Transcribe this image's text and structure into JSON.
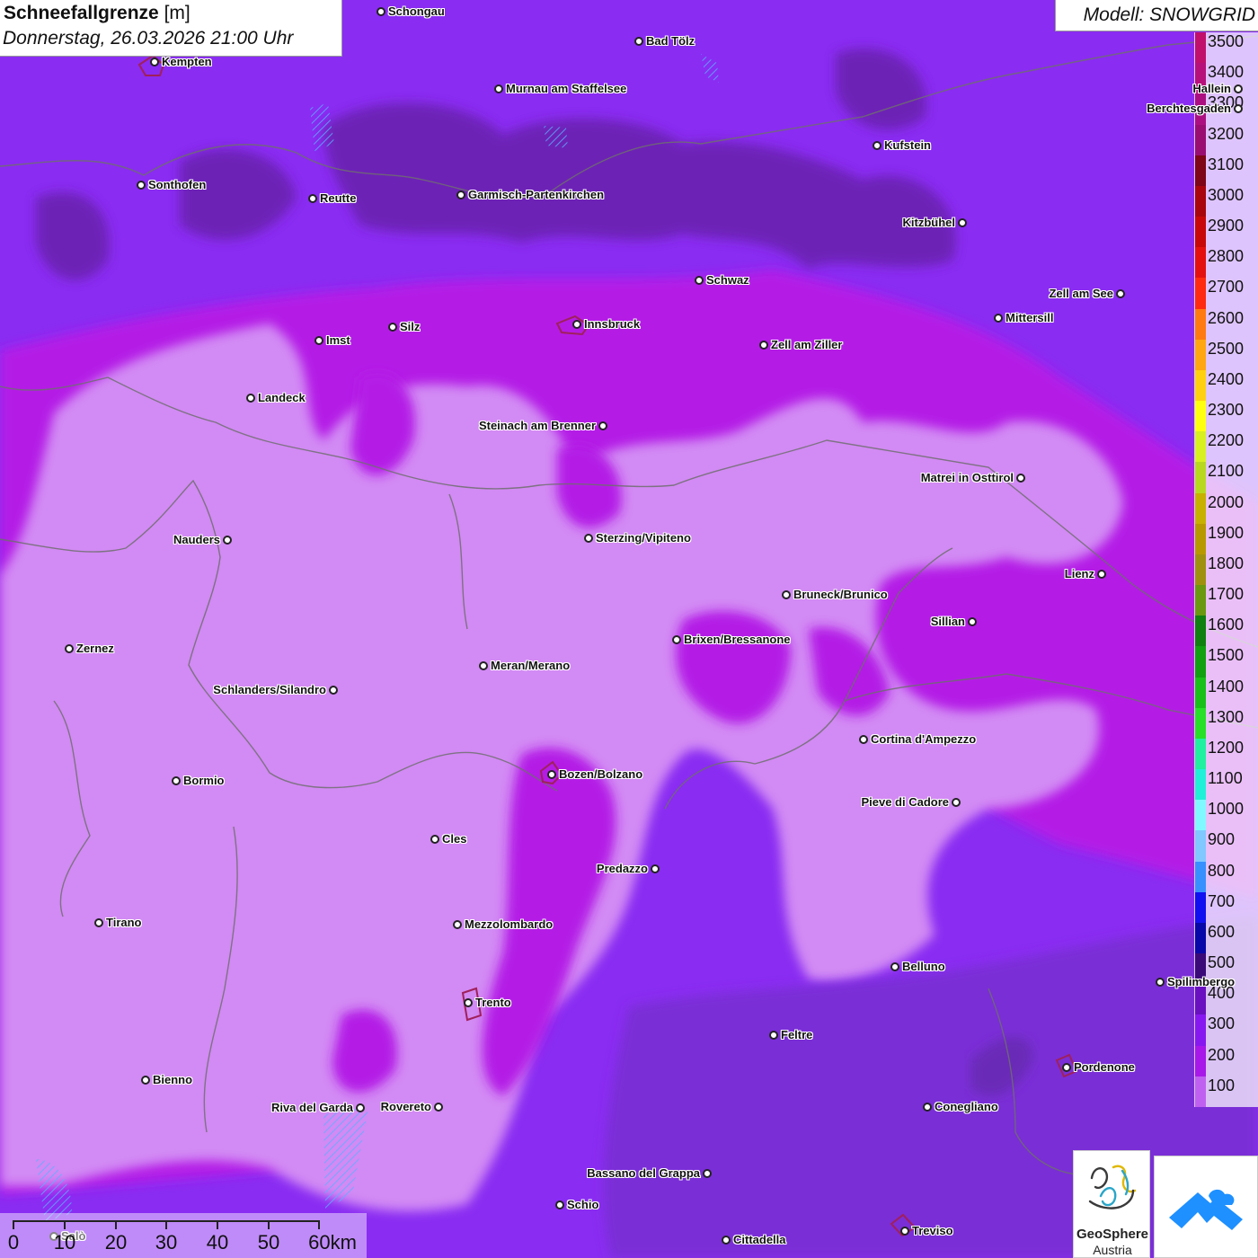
{
  "header": {
    "title": "Schneefallgrenze",
    "unit": "[m]",
    "datetime": "Donnerstag, 26.03.2026 21:00 Uhr"
  },
  "model": {
    "label": "Modell: SNOWGRID"
  },
  "legend": {
    "values": [
      "3500",
      "3400",
      "3300",
      "3200",
      "3100",
      "3000",
      "2900",
      "2800",
      "2700",
      "2600",
      "2500",
      "2400",
      "2300",
      "2200",
      "2100",
      "2000",
      "1900",
      "1800",
      "1700",
      "1600",
      "1500",
      "1400",
      "1300",
      "1200",
      "1100",
      "1000",
      "900",
      "800",
      "700",
      "600",
      "500",
      "400",
      "300",
      "200",
      "100"
    ],
    "colors": [
      "#c0106c",
      "#b8107a",
      "#ac1080",
      "#9a0e72",
      "#7e0616",
      "#a8060c",
      "#c80808",
      "#e41010",
      "#ff2a10",
      "#ff7a10",
      "#ffa610",
      "#ffd010",
      "#ffff10",
      "#d8f020",
      "#b8d820",
      "#c8b000",
      "#b89800",
      "#a09010",
      "#6a9810",
      "#108010",
      "#10a010",
      "#18c018",
      "#28e028",
      "#20f0a0",
      "#20f0d8",
      "#80f8ff",
      "#80c8ff",
      "#3890ff",
      "#1010f0",
      "#0808a8",
      "#3a0a78",
      "#6a10c0",
      "#8818f0",
      "#a818e8",
      "#c060f0"
    ]
  },
  "map": {
    "cities": [
      {
        "name": "Schongau"
      },
      {
        "name": "Bad Tölz"
      },
      {
        "name": "Kempten"
      },
      {
        "name": "Murnau am Staffelsee"
      },
      {
        "name": "Berchtesgaden"
      },
      {
        "name": "Hallein"
      },
      {
        "name": "Kufstein"
      },
      {
        "name": "Sonthofen"
      },
      {
        "name": "Reutte"
      },
      {
        "name": "Garmisch-Partenkirchen"
      },
      {
        "name": "Kitzbühel"
      },
      {
        "name": "Schwaz"
      },
      {
        "name": "Zell am See"
      },
      {
        "name": "Mittersill"
      },
      {
        "name": "Innsbruck"
      },
      {
        "name": "Silz"
      },
      {
        "name": "Imst"
      },
      {
        "name": "Zell am Ziller"
      },
      {
        "name": "Landeck"
      },
      {
        "name": "Steinach am Brenner"
      },
      {
        "name": "Matrei in Osttirol"
      },
      {
        "name": "Nauders"
      },
      {
        "name": "Sterzing/Vipiteno"
      },
      {
        "name": "Lienz"
      },
      {
        "name": "Bruneck/Brunico"
      },
      {
        "name": "Sillian"
      },
      {
        "name": "Brixen/Bressanone"
      },
      {
        "name": "Zernez"
      },
      {
        "name": "Meran/Merano"
      },
      {
        "name": "Schlanders/Silandro"
      },
      {
        "name": "Cortina d'Ampezzo"
      },
      {
        "name": "Bozen/Bolzano"
      },
      {
        "name": "Bormio"
      },
      {
        "name": "Pieve di Cadore"
      },
      {
        "name": "Cles"
      },
      {
        "name": "Predazzo"
      },
      {
        "name": "Tirano"
      },
      {
        "name": "Mezzolombardo"
      },
      {
        "name": "Belluno"
      },
      {
        "name": "Spilimbergo"
      },
      {
        "name": "Trento"
      },
      {
        "name": "Feltre"
      },
      {
        "name": "Pordenone"
      },
      {
        "name": "Bienno"
      },
      {
        "name": "Riva del Garda"
      },
      {
        "name": "Rovereto"
      },
      {
        "name": "Conegliano"
      },
      {
        "name": "Bassano del Grappa"
      },
      {
        "name": "Schio"
      },
      {
        "name": "Treviso"
      },
      {
        "name": "Cittadella"
      },
      {
        "name": "Salò"
      }
    ]
  },
  "scale_bar": {
    "labels": [
      "0",
      "10",
      "20",
      "30",
      "40",
      "50",
      "60km"
    ]
  },
  "logos": {
    "geosphere_name": "GeoSphere",
    "geosphere_sub": "Austria"
  }
}
